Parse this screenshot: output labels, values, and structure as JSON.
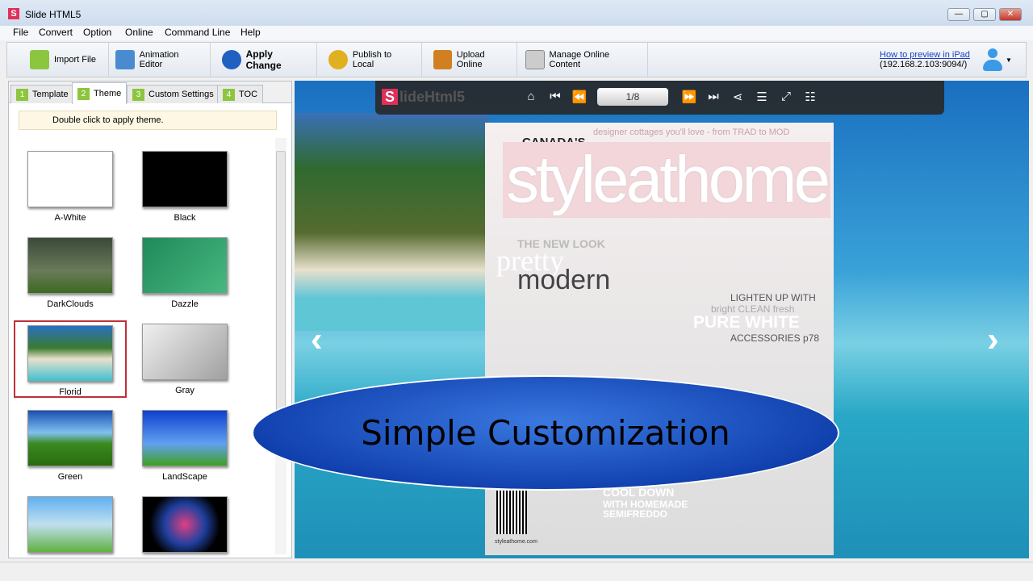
{
  "window": {
    "title": "Slide HTML5",
    "logo": "S",
    "minimize": "—",
    "maximize": "▢",
    "close": "✕"
  },
  "menu": [
    "File",
    "Convert",
    "Option",
    "Online",
    "Command Line",
    "Help"
  ],
  "toolbar": [
    {
      "label": "Import File",
      "icon": "import-file-icon",
      "color": "#8cc63f"
    },
    {
      "label": "Animation Editor",
      "icon": "animation-editor-icon",
      "color": "#4a8ad0"
    },
    {
      "label": "Apply Change",
      "icon": "apply-change-icon",
      "color": "#2060c0"
    },
    {
      "label": "Publish to Local",
      "icon": "publish-gears-icon",
      "color": "#e0b020"
    },
    {
      "label": "Upload Online",
      "icon": "upload-online-icon",
      "color": "#d08020"
    },
    {
      "label": "Manage Online Content",
      "icon": "manage-content-icon",
      "color": "#999999"
    }
  ],
  "ipad": {
    "link": "How to preview in iPad",
    "address": "(192.168.2.103:9094/)"
  },
  "tabs": [
    {
      "num": "1",
      "label": "Template"
    },
    {
      "num": "2",
      "label": "Theme"
    },
    {
      "num": "3",
      "label": "Custom Settings"
    },
    {
      "num": "4",
      "label": "TOC"
    }
  ],
  "hint": "Double click to apply theme.",
  "themes": [
    {
      "label": "A-White",
      "bg": "#ffffff"
    },
    {
      "label": "Black",
      "bg": "#000000"
    },
    {
      "label": "DarkClouds",
      "bg": "linear-gradient(#3a4a3a,#6a7a5a 60%,#3d6a20)"
    },
    {
      "label": "Dazzle",
      "bg": "linear-gradient(135deg,#1f8a5a,#48b880)"
    },
    {
      "label": "Florid",
      "bg": "linear-gradient(#2a70c0,#3a7a30 40%,#e8e0cc 60%,#40c0d0)"
    },
    {
      "label": "Gray",
      "bg": "linear-gradient(135deg,#f0f0f0,#a0a0a0)"
    },
    {
      "label": "Green",
      "bg": "linear-gradient(#1a50b0,#80c0f0 40%,#3a8a20 60%,#2a6a10)"
    },
    {
      "label": "LandScape",
      "bg": "linear-gradient(#1040d0,#60a0f0 60%,#40a020)"
    },
    {
      "label": "",
      "bg": "linear-gradient(#60b0f0,#c0e0f0 50%,#60b040)"
    },
    {
      "label": "",
      "bg": "radial-gradient(circle,#e04080,#2040a0 40%,#000 70%)"
    }
  ],
  "selected_theme": "Florid",
  "viewer": {
    "brand_s": "S",
    "brand": "lideHtml5",
    "page": "1/8"
  },
  "magazine": {
    "top": "CANADA'S",
    "title": "styleathome",
    "tagline": "designer cottages you'll love - from TRAD to MOD",
    "look": "THE NEW LOOK",
    "pretty": "pretty",
    "modern": "modern",
    "lighten": "LIGHTEN UP WITH",
    "bright": "bright CLEAN fresh",
    "pure": "PURE WHITE",
    "acc": "ACCESSORIES p78",
    "cool": "COOL DOWN",
    "with": "WITH HOMEMADE",
    "semi": "SEMIFREDDO",
    "site": "styleathome.com"
  },
  "banner": "Simple Customization"
}
